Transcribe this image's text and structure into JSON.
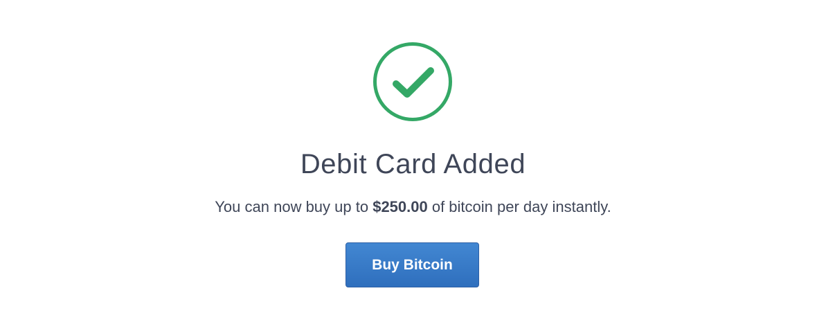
{
  "success": {
    "icon": "check-circle-icon",
    "title": "Debit Card Added",
    "message_prefix": "You can now buy up to ",
    "limit_amount": "$250.00",
    "message_suffix": " of bitcoin per day instantly.",
    "button_label": "Buy Bitcoin"
  },
  "colors": {
    "success_green": "#34a866",
    "text": "#3f4658",
    "button_blue": "#377bc8"
  }
}
